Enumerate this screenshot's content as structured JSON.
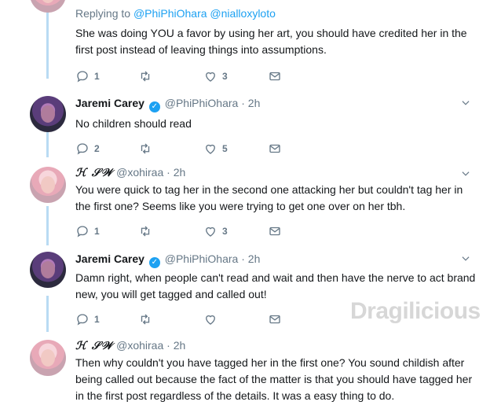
{
  "tweets": [
    {
      "reply_prefix": "Replying to",
      "reply_mentions": "@PhiPhiOhara @nialloxyloto",
      "text": "She was doing YOU a favor by using her art, you should have credited her in the first post instead of leaving things into assumptions.",
      "reply_count": "1",
      "like_count": "3"
    },
    {
      "name": "Jaremi Carey",
      "handle": "@PhiPhiOhara",
      "time": "2h",
      "text": "No children should read",
      "reply_count": "2",
      "like_count": "5"
    },
    {
      "name": "ℋ 𝒮𝒲",
      "handle": "@xohiraa",
      "time": "2h",
      "text": "You were quick to tag her in the second one attacking her but couldn't tag her in the first one? Seems like you were trying to get one over on her tbh.",
      "reply_count": "1",
      "like_count": "3"
    },
    {
      "name": "Jaremi Carey",
      "handle": "@PhiPhiOhara",
      "time": "2h",
      "text": "Damn right, when people can't read and wait and then have the nerve to act brand new, you will get tagged and called out!",
      "reply_count": "1",
      "like_count": ""
    },
    {
      "name": "ℋ 𝒮𝒲",
      "handle": "@xohiraa",
      "time": "2h",
      "text": "Then why couldn't you have tagged her in the first one? You sound childish after being called out because the fact of the matter is that you should have tagged her in the first post regardless of the details. It was a easy thing to do."
    }
  ],
  "watermark": "Dragilicious",
  "colors": {
    "thread_line": "#b9dbf3",
    "link": "#1da1f2",
    "muted": "#657786",
    "verified": "#1da1f2"
  },
  "icons": [
    "reply-icon",
    "retweet-icon",
    "like-icon",
    "message-icon",
    "caret-down-icon",
    "verified-badge-icon"
  ]
}
